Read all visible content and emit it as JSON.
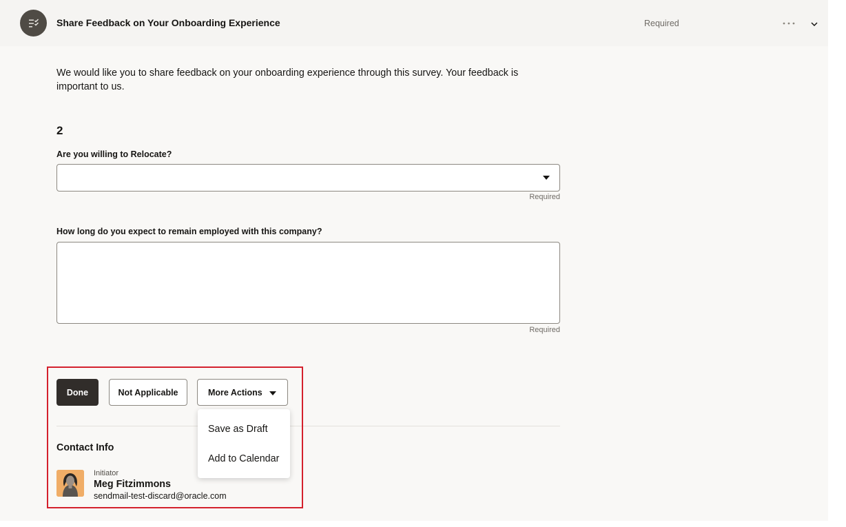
{
  "task": {
    "title": "Share Feedback on Your Onboarding Experience",
    "status": "Required",
    "icon": "checklist-icon"
  },
  "intro_text": "We would like you to share feedback on your onboarding experience through this survey. Your feedback is important to us.",
  "question_number": "2",
  "questions": [
    {
      "label": "Are you willing to Relocate?",
      "type": "select",
      "value": "",
      "required_text": "Required"
    },
    {
      "label": "How long do you expect to remain employed with this company?",
      "type": "textarea",
      "value": "",
      "required_text": "Required"
    }
  ],
  "actions": {
    "done": "Done",
    "not_applicable": "Not Applicable",
    "more_actions": "More Actions",
    "menu": [
      "Save as Draft",
      "Add to Calendar"
    ]
  },
  "contact": {
    "heading": "Contact Info",
    "role": "Initiator",
    "name": "Meg Fitzimmons",
    "email": "sendmail-test-discard@oracle.com"
  },
  "colors": {
    "primary_button": "#312d2a",
    "highlight": "#d4202c",
    "panel_background": "#f9f8f6"
  }
}
